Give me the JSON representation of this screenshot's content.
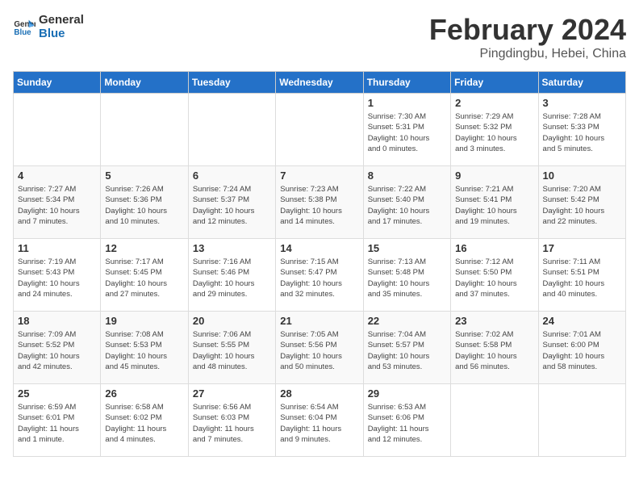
{
  "logo": {
    "text_general": "General",
    "text_blue": "Blue"
  },
  "title": "February 2024",
  "subtitle": "Pingdingbu, Hebei, China",
  "headers": [
    "Sunday",
    "Monday",
    "Tuesday",
    "Wednesday",
    "Thursday",
    "Friday",
    "Saturday"
  ],
  "weeks": [
    [
      {
        "day": "",
        "info": ""
      },
      {
        "day": "",
        "info": ""
      },
      {
        "day": "",
        "info": ""
      },
      {
        "day": "",
        "info": ""
      },
      {
        "day": "1",
        "info": "Sunrise: 7:30 AM\nSunset: 5:31 PM\nDaylight: 10 hours\nand 0 minutes."
      },
      {
        "day": "2",
        "info": "Sunrise: 7:29 AM\nSunset: 5:32 PM\nDaylight: 10 hours\nand 3 minutes."
      },
      {
        "day": "3",
        "info": "Sunrise: 7:28 AM\nSunset: 5:33 PM\nDaylight: 10 hours\nand 5 minutes."
      }
    ],
    [
      {
        "day": "4",
        "info": "Sunrise: 7:27 AM\nSunset: 5:34 PM\nDaylight: 10 hours\nand 7 minutes."
      },
      {
        "day": "5",
        "info": "Sunrise: 7:26 AM\nSunset: 5:36 PM\nDaylight: 10 hours\nand 10 minutes."
      },
      {
        "day": "6",
        "info": "Sunrise: 7:24 AM\nSunset: 5:37 PM\nDaylight: 10 hours\nand 12 minutes."
      },
      {
        "day": "7",
        "info": "Sunrise: 7:23 AM\nSunset: 5:38 PM\nDaylight: 10 hours\nand 14 minutes."
      },
      {
        "day": "8",
        "info": "Sunrise: 7:22 AM\nSunset: 5:40 PM\nDaylight: 10 hours\nand 17 minutes."
      },
      {
        "day": "9",
        "info": "Sunrise: 7:21 AM\nSunset: 5:41 PM\nDaylight: 10 hours\nand 19 minutes."
      },
      {
        "day": "10",
        "info": "Sunrise: 7:20 AM\nSunset: 5:42 PM\nDaylight: 10 hours\nand 22 minutes."
      }
    ],
    [
      {
        "day": "11",
        "info": "Sunrise: 7:19 AM\nSunset: 5:43 PM\nDaylight: 10 hours\nand 24 minutes."
      },
      {
        "day": "12",
        "info": "Sunrise: 7:17 AM\nSunset: 5:45 PM\nDaylight: 10 hours\nand 27 minutes."
      },
      {
        "day": "13",
        "info": "Sunrise: 7:16 AM\nSunset: 5:46 PM\nDaylight: 10 hours\nand 29 minutes."
      },
      {
        "day": "14",
        "info": "Sunrise: 7:15 AM\nSunset: 5:47 PM\nDaylight: 10 hours\nand 32 minutes."
      },
      {
        "day": "15",
        "info": "Sunrise: 7:13 AM\nSunset: 5:48 PM\nDaylight: 10 hours\nand 35 minutes."
      },
      {
        "day": "16",
        "info": "Sunrise: 7:12 AM\nSunset: 5:50 PM\nDaylight: 10 hours\nand 37 minutes."
      },
      {
        "day": "17",
        "info": "Sunrise: 7:11 AM\nSunset: 5:51 PM\nDaylight: 10 hours\nand 40 minutes."
      }
    ],
    [
      {
        "day": "18",
        "info": "Sunrise: 7:09 AM\nSunset: 5:52 PM\nDaylight: 10 hours\nand 42 minutes."
      },
      {
        "day": "19",
        "info": "Sunrise: 7:08 AM\nSunset: 5:53 PM\nDaylight: 10 hours\nand 45 minutes."
      },
      {
        "day": "20",
        "info": "Sunrise: 7:06 AM\nSunset: 5:55 PM\nDaylight: 10 hours\nand 48 minutes."
      },
      {
        "day": "21",
        "info": "Sunrise: 7:05 AM\nSunset: 5:56 PM\nDaylight: 10 hours\nand 50 minutes."
      },
      {
        "day": "22",
        "info": "Sunrise: 7:04 AM\nSunset: 5:57 PM\nDaylight: 10 hours\nand 53 minutes."
      },
      {
        "day": "23",
        "info": "Sunrise: 7:02 AM\nSunset: 5:58 PM\nDaylight: 10 hours\nand 56 minutes."
      },
      {
        "day": "24",
        "info": "Sunrise: 7:01 AM\nSunset: 6:00 PM\nDaylight: 10 hours\nand 58 minutes."
      }
    ],
    [
      {
        "day": "25",
        "info": "Sunrise: 6:59 AM\nSunset: 6:01 PM\nDaylight: 11 hours\nand 1 minute."
      },
      {
        "day": "26",
        "info": "Sunrise: 6:58 AM\nSunset: 6:02 PM\nDaylight: 11 hours\nand 4 minutes."
      },
      {
        "day": "27",
        "info": "Sunrise: 6:56 AM\nSunset: 6:03 PM\nDaylight: 11 hours\nand 7 minutes."
      },
      {
        "day": "28",
        "info": "Sunrise: 6:54 AM\nSunset: 6:04 PM\nDaylight: 11 hours\nand 9 minutes."
      },
      {
        "day": "29",
        "info": "Sunrise: 6:53 AM\nSunset: 6:06 PM\nDaylight: 11 hours\nand 12 minutes."
      },
      {
        "day": "",
        "info": ""
      },
      {
        "day": "",
        "info": ""
      }
    ]
  ]
}
